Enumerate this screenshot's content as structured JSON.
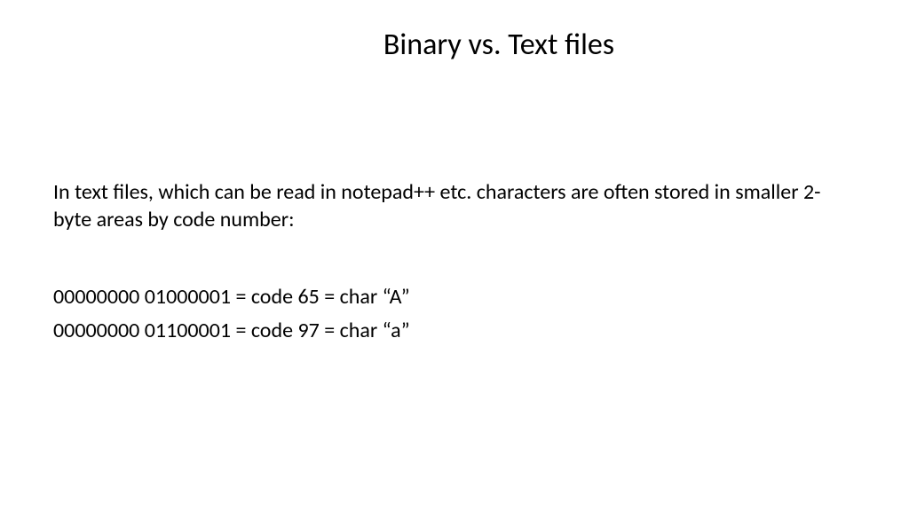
{
  "slide": {
    "title": "Binary vs. Text files",
    "body": "In text files, which can be read in notepad++ etc. characters are often stored in smaller 2-byte areas by code number:",
    "examples": [
      "00000000 01000001 =  code 65  = char  “A”",
      "00000000 01100001 =  code 97  = char  “a”"
    ]
  }
}
